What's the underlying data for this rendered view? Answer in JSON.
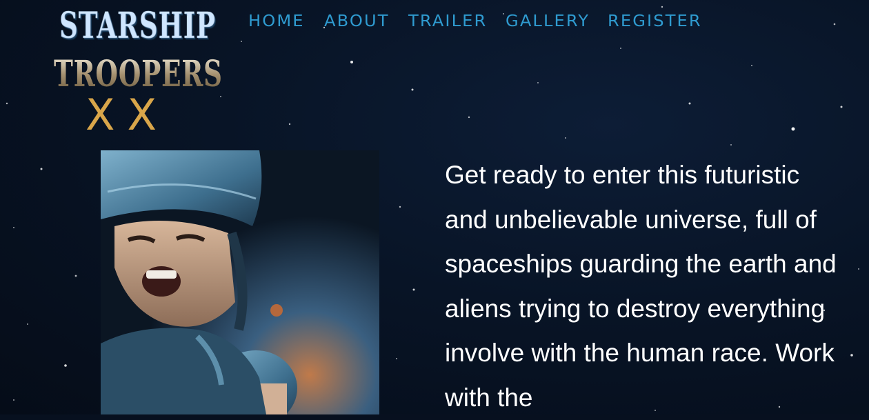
{
  "logo": {
    "line1": "STARSHIP",
    "line2": "TROOPERS",
    "line3": "XX"
  },
  "nav": {
    "items": [
      {
        "label": "HOME"
      },
      {
        "label": "ABOUT"
      },
      {
        "label": "TRAILER"
      },
      {
        "label": "GALLERY"
      },
      {
        "label": "REGISTER"
      }
    ]
  },
  "hero": {
    "poster_icon": "soldier-poster-image",
    "intro_text": "Get ready to enter this futuristic and unbelievable universe, full of spaceships guarding the earth and aliens trying to destroy everything involve with the human race. Work with the"
  },
  "colors": {
    "background": "#07101f",
    "nav_link": "#2f9bd0",
    "logo_gold": "#d9a64a",
    "text": "#ffffff"
  }
}
